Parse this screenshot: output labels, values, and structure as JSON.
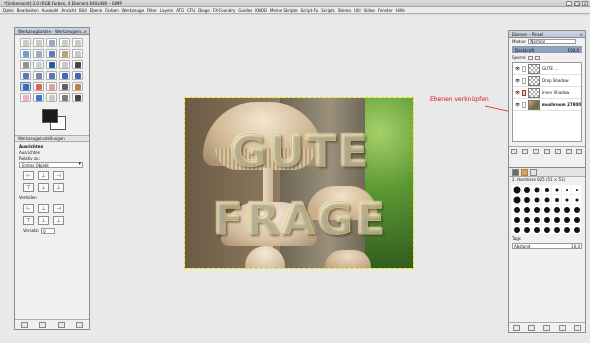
{
  "window": {
    "title": "*[Unbenannt]-3.0 (RGB Farben, 4 Ebenen) 640x480 – GIMP",
    "buttons": [
      "_",
      "□",
      "×"
    ]
  },
  "menubar": [
    "Datei",
    "Bearbeiten",
    "Auswahl",
    "Ansicht",
    "Bild",
    "Ebene",
    "Farben",
    "Werkzeuge",
    "Filter",
    "Layers",
    "ATG",
    "CFU",
    "Diego",
    "FX-Foundry",
    "Guides",
    "KNOD",
    "Meine Skripte",
    "Script-Fu",
    "Scripts",
    "Stereo",
    "Util",
    "Video",
    "Fenster",
    "Hilfe"
  ],
  "toolbox": {
    "title": "Werkzeugkasten - Werkzeugein...",
    "options_tab": "Werkzeugeinstellungen",
    "options": {
      "heading": "Ausrichten",
      "sub": "Ausrichten",
      "relative_label": "Relativ zu:",
      "relative_value": "Erstes Objekt",
      "distribute_label": "Verteilen",
      "offset_label": "Versatz:",
      "offset_value": "0"
    }
  },
  "image": {
    "text_line1": "GUTE",
    "text_line2": "FRAGE"
  },
  "annotation": "Ebenen verknüpfen",
  "layers_panel": {
    "title": "Ebenen – Pinsel",
    "mode_label": "Modus:",
    "mode_value": "Normal",
    "opacity_label": "Deckkraft",
    "opacity_value": "100,0",
    "lock_label": "Sperre:",
    "layers": [
      {
        "name": "GUTE ...",
        "visible": true,
        "linked": false,
        "thumb": "checker",
        "bold": false
      },
      {
        "name": "Drop Shadow",
        "visible": true,
        "linked": false,
        "thumb": "checker",
        "bold": false
      },
      {
        "name": "Inner Shadow",
        "visible": true,
        "linked": true,
        "thumb": "checker",
        "bold": false
      },
      {
        "name": "mushroom 27800",
        "visible": true,
        "linked": false,
        "thumb": "photo",
        "bold": true
      }
    ]
  },
  "brushes_panel": {
    "title": "2. Hardness 025 (51 × 51)",
    "tag_label": "Tags",
    "spacing_label": "Abstand",
    "spacing_value": "10,0"
  }
}
